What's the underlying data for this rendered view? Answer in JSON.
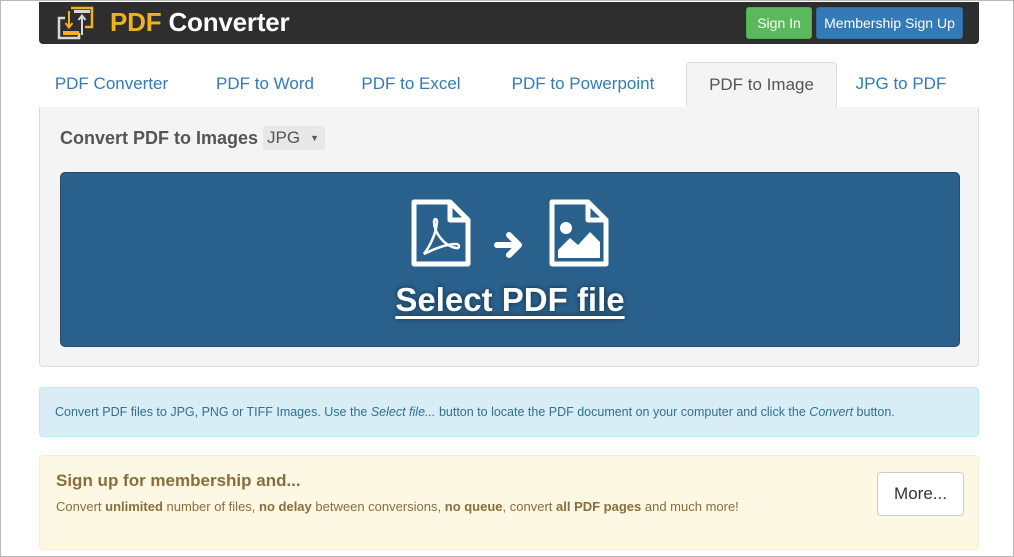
{
  "header": {
    "brand_part1": "PDF",
    "brand_part2": "Converter",
    "logo_icon": "convert-arrows-icon",
    "sign_in_label": "Sign In",
    "membership_label": "Membership Sign Up",
    "colors": {
      "brand_accent": "#f0b11f",
      "sign_in": "#5cb85c",
      "membership": "#337ab7",
      "bar": "#2e2e2e"
    }
  },
  "tabs": [
    {
      "label": "PDF Converter",
      "active": false
    },
    {
      "label": "PDF to Word",
      "active": false
    },
    {
      "label": "PDF to Excel",
      "active": false
    },
    {
      "label": "PDF to Powerpoint",
      "active": false
    },
    {
      "label": "PDF to Image",
      "active": true
    },
    {
      "label": "JPG to PDF",
      "active": false
    }
  ],
  "converter": {
    "label": "Convert PDF to Images",
    "format_selected": "JPG",
    "drop_zone": {
      "source_icon": "pdf-file-icon",
      "arrow_icon": "arrow-right-icon",
      "target_icon": "image-file-icon",
      "label": "Select PDF file",
      "color": "#29608c"
    }
  },
  "info": {
    "part1": "Convert PDF files to JPG, PNG or TIFF Images. Use the ",
    "em1": "Select file...",
    "part2": " button to locate the PDF document on your computer and click the ",
    "em2": "Convert",
    "part3": " button."
  },
  "promo": {
    "title": "Sign up for membership and...",
    "t1": "Convert ",
    "b1": "unlimited",
    "t2": " number of files, ",
    "b2": "no delay",
    "t3": " between conversions, ",
    "b3": "no queue",
    "t4": ", convert ",
    "b4": "all PDF pages",
    "t5": " and much more!",
    "more_label": "More..."
  }
}
